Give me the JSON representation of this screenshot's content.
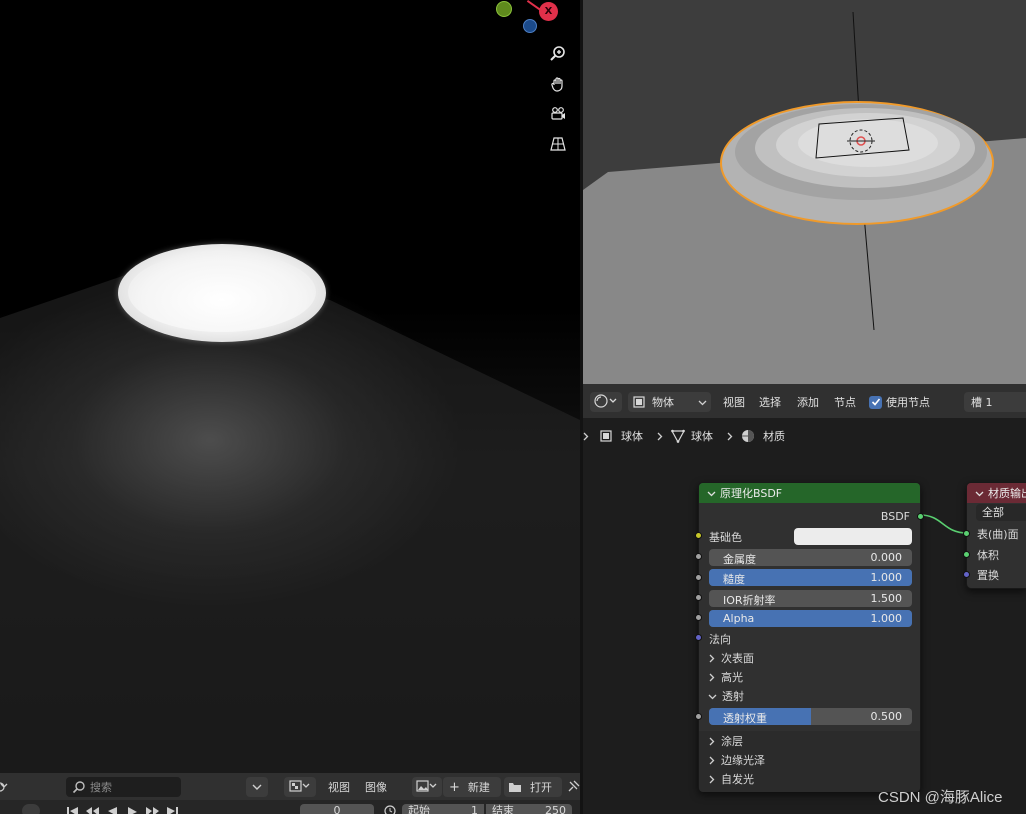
{
  "left_toolbar": {
    "search_placeholder": "搜索",
    "view_label": "视图",
    "image_label": "图像",
    "new_label": "新建",
    "open_label": "打开"
  },
  "timeline": {
    "frame_value": "0",
    "start_label": "起始",
    "start_value": "1",
    "end_label": "结束",
    "end_value": "250"
  },
  "gizmo": {
    "x_label": "X"
  },
  "node_header": {
    "mode_label": "物体",
    "view_label": "视图",
    "select_label": "选择",
    "add_label": "添加",
    "node_label": "节点",
    "use_nodes_label": "使用节点",
    "slot_label": "槽 1"
  },
  "breadcrumb": {
    "object_label": "球体",
    "mesh_label": "球体",
    "material_label": "材质"
  },
  "bsdf_node": {
    "title": "原理化BSDF",
    "output_label": "BSDF",
    "base_color_label": "基础色",
    "metallic": {
      "label": "金属度",
      "value": "0.000",
      "fill": 0.0
    },
    "roughness": {
      "label": "糙度",
      "value": "1.000",
      "fill": 1.0
    },
    "ior": {
      "label": "IOR折射率",
      "value": "1.500",
      "fill": 0.0
    },
    "alpha": {
      "label": "Alpha",
      "value": "1.000",
      "fill": 1.0
    },
    "normal_label": "法向",
    "subsurface_label": "次表面",
    "specular_label": "高光",
    "transmission_label": "透射",
    "transmission_weight": {
      "label": "透射权重",
      "value": "0.500",
      "fill": 0.5
    },
    "coat_label": "涂层",
    "sheen_label": "边缘光泽",
    "emission_label": "自发光"
  },
  "output_node": {
    "title": "材质输出",
    "target_label": "全部",
    "surface_label": "表(曲)面",
    "volume_label": "体积",
    "displacement_label": "置换"
  },
  "watermark": "CSDN @海豚Alice",
  "colors": {
    "accent_blue": "#4772b3",
    "bsdf_header": "#256629",
    "output_header": "#6b2a35",
    "selection_orange": "#f09a2a"
  }
}
